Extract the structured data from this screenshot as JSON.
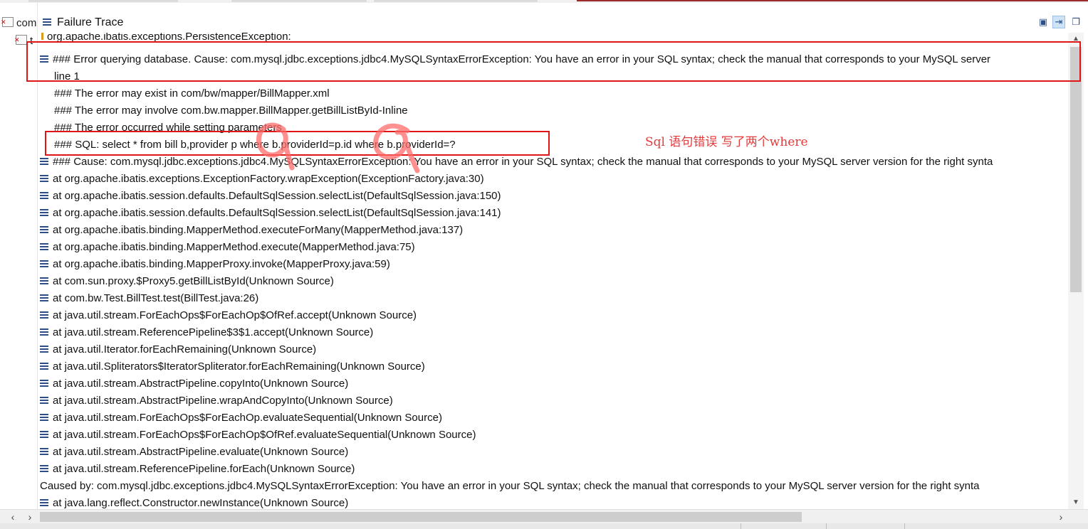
{
  "window": {
    "view_title": "Failure Trace",
    "left_tree_label": "com",
    "left_tree_sub": "t"
  },
  "trace": [
    {
      "kind": "exception",
      "text": "org.apache.ibatis.exceptions.PersistenceException:"
    },
    {
      "kind": "frame",
      "text": "### Error querying database.  Cause: com.mysql.jdbc.exceptions.jdbc4.MySQLSyntaxErrorException: You have an error in your SQL syntax; check the manual that corresponds to your MySQL server"
    },
    {
      "kind": "cont",
      "text": "line 1"
    },
    {
      "kind": "cont",
      "text": "### The error may exist in com/bw/mapper/BillMapper.xml"
    },
    {
      "kind": "cont",
      "text": "### The error may involve com.bw.mapper.BillMapper.getBillListById-Inline"
    },
    {
      "kind": "cont",
      "text": "### The error occurred while setting parameters"
    },
    {
      "kind": "cont",
      "text": "### SQL: select * from bill b,provider p where b.providerId=p.id where b.providerId=?"
    },
    {
      "kind": "frame",
      "text": "### Cause: com.mysql.jdbc.exceptions.jdbc4.MySQLSyntaxErrorException: You have an error in your SQL syntax; check the manual that corresponds to your MySQL server version for the right synta"
    },
    {
      "kind": "frame",
      "text": "at org.apache.ibatis.exceptions.ExceptionFactory.wrapException(ExceptionFactory.java:30)"
    },
    {
      "kind": "frame",
      "text": "at org.apache.ibatis.session.defaults.DefaultSqlSession.selectList(DefaultSqlSession.java:150)"
    },
    {
      "kind": "frame",
      "text": "at org.apache.ibatis.session.defaults.DefaultSqlSession.selectList(DefaultSqlSession.java:141)"
    },
    {
      "kind": "frame",
      "text": "at org.apache.ibatis.binding.MapperMethod.executeForMany(MapperMethod.java:137)"
    },
    {
      "kind": "frame",
      "text": "at org.apache.ibatis.binding.MapperMethod.execute(MapperMethod.java:75)"
    },
    {
      "kind": "frame",
      "text": "at org.apache.ibatis.binding.MapperProxy.invoke(MapperProxy.java:59)"
    },
    {
      "kind": "frame",
      "text": "at com.sun.proxy.$Proxy5.getBillListById(Unknown Source)"
    },
    {
      "kind": "frame",
      "text": "at com.bw.Test.BillTest.test(BillTest.java:26)"
    },
    {
      "kind": "frame",
      "text": "at java.util.stream.ForEachOps$ForEachOp$OfRef.accept(Unknown Source)"
    },
    {
      "kind": "frame",
      "text": "at java.util.stream.ReferencePipeline$3$1.accept(Unknown Source)"
    },
    {
      "kind": "frame",
      "text": "at java.util.Iterator.forEachRemaining(Unknown Source)"
    },
    {
      "kind": "frame",
      "text": "at java.util.Spliterators$IteratorSpliterator.forEachRemaining(Unknown Source)"
    },
    {
      "kind": "frame",
      "text": "at java.util.stream.AbstractPipeline.copyInto(Unknown Source)"
    },
    {
      "kind": "frame",
      "text": "at java.util.stream.AbstractPipeline.wrapAndCopyInto(Unknown Source)"
    },
    {
      "kind": "frame",
      "text": "at java.util.stream.ForEachOps$ForEachOp.evaluateSequential(Unknown Source)"
    },
    {
      "kind": "frame",
      "text": "at java.util.stream.ForEachOps$ForEachOp$OfRef.evaluateSequential(Unknown Source)"
    },
    {
      "kind": "frame",
      "text": "at java.util.stream.AbstractPipeline.evaluate(Unknown Source)"
    },
    {
      "kind": "frame",
      "text": "at java.util.stream.ReferencePipeline.forEach(Unknown Source)"
    },
    {
      "kind": "caused",
      "text": "Caused by: com.mysql.jdbc.exceptions.jdbc4.MySQLSyntaxErrorException: You have an error in your SQL syntax; check the manual that corresponds to your MySQL server version for the right synta"
    },
    {
      "kind": "frame",
      "text": "at java.lang.reflect.Constructor.newInstance(Unknown Source)"
    }
  ],
  "annotation": {
    "text": "Sql 语句错误  写了两个where",
    "color": "#e23a3a"
  },
  "colors": {
    "highlight_box": "#e01515",
    "icon_blue": "#2b4f86"
  },
  "icons": [
    "list-icon",
    "warning-icon",
    "failures-filter-icon",
    "compare-icon",
    "copy-trace-icon",
    "test-error-icon"
  ]
}
